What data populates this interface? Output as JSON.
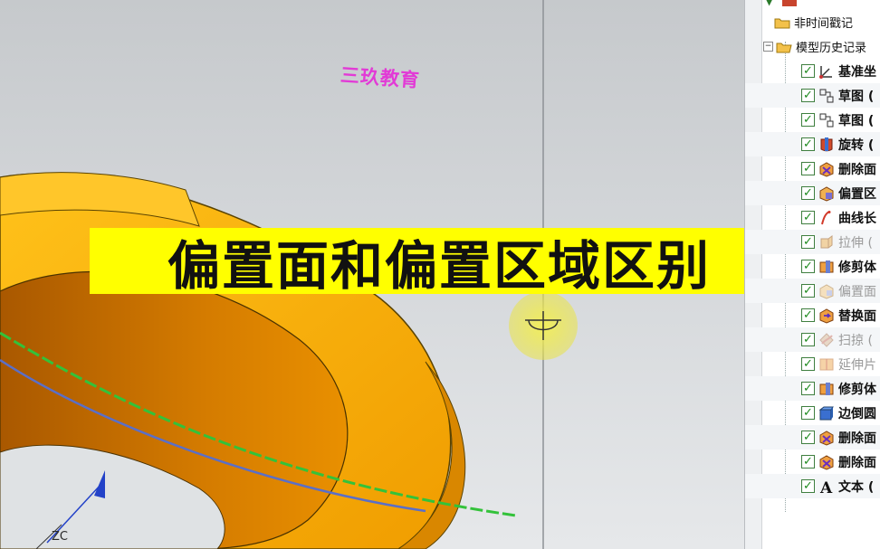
{
  "viewport": {
    "watermark": "三玖教育",
    "caption": "偏置面和偏置区域区别",
    "axis_label": "ZC"
  },
  "navigator": {
    "folders": [
      {
        "label": "非时间戳记"
      },
      {
        "label": "模型历史记录"
      }
    ],
    "features": [
      {
        "label": "基准坐",
        "icon": "datum-csys-icon",
        "enabled": true
      },
      {
        "label": "草图 (",
        "icon": "sketch-icon",
        "enabled": true
      },
      {
        "label": "草图 (",
        "icon": "sketch-icon",
        "enabled": true
      },
      {
        "label": "旋转 (",
        "icon": "revolve-icon",
        "enabled": true
      },
      {
        "label": "删除面",
        "icon": "delete-face-icon",
        "enabled": true
      },
      {
        "label": "偏置区",
        "icon": "offset-region-icon",
        "enabled": true
      },
      {
        "label": "曲线长",
        "icon": "curve-length-icon",
        "enabled": true
      },
      {
        "label": "拉伸 (",
        "icon": "extrude-icon",
        "enabled": false
      },
      {
        "label": "修剪体",
        "icon": "trim-body-icon",
        "enabled": true
      },
      {
        "label": "偏置面",
        "icon": "offset-face-icon",
        "enabled": false
      },
      {
        "label": "替换面",
        "icon": "replace-face-icon",
        "enabled": true
      },
      {
        "label": "扫掠 (",
        "icon": "swept-icon",
        "enabled": false
      },
      {
        "label": "延伸片",
        "icon": "extend-sheet-icon",
        "enabled": false
      },
      {
        "label": "修剪体",
        "icon": "trim-body-icon",
        "enabled": true
      },
      {
        "label": "边倒圆",
        "icon": "edge-blend-icon",
        "enabled": true
      },
      {
        "label": "删除面",
        "icon": "delete-face-icon",
        "enabled": true
      },
      {
        "label": "删除面",
        "icon": "delete-face-icon",
        "enabled": true
      },
      {
        "label": "文本 (",
        "icon": "text-icon",
        "enabled": true
      }
    ]
  },
  "colors": {
    "part_face": "#f5ab0c",
    "part_inner": "#c06a00",
    "curve_green": "#33c23a",
    "curve_blue": "#5a6fc8",
    "caption_bg": "#ffff00",
    "watermark": "#e23ad6"
  }
}
